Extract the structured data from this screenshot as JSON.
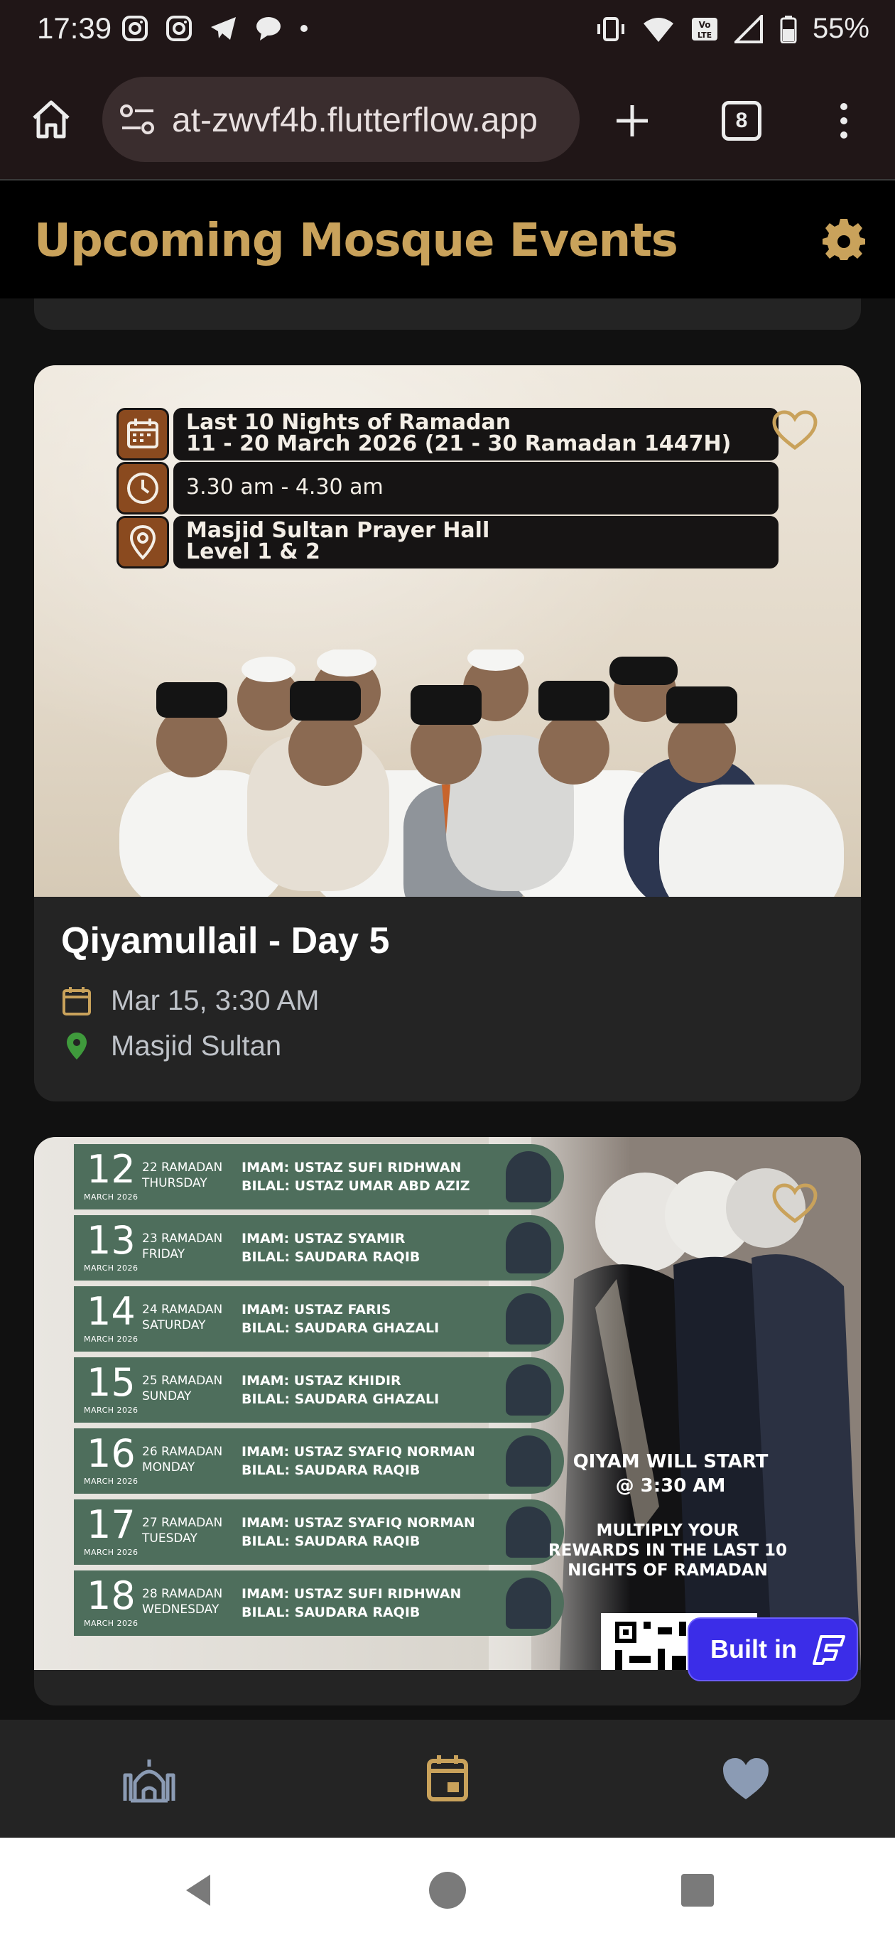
{
  "status_bar": {
    "time": "17:39",
    "battery": "55%",
    "icons_left": [
      "instagram-icon",
      "instagram-icon",
      "telegram-icon",
      "chat-icon",
      "dot-icon"
    ],
    "icons_right": [
      "vibrate-icon",
      "wifi-icon",
      "volte-icon",
      "signal-icon",
      "battery-icon"
    ]
  },
  "browser": {
    "url": "at-zwvf4b.flutterflow.app",
    "tab_count": "8"
  },
  "app": {
    "title": "Upcoming Mosque Events",
    "accent": "#c9a25b"
  },
  "events": [
    {
      "poster": {
        "line1": "Last 10 Nights of Ramadan",
        "line2": "11 - 20 March 2026 (21 - 30 Ramadan 1447H)",
        "time": "3.30 am - 4.30 am",
        "place1": "Masjid Sultan Prayer Hall",
        "place2": "Level 1 & 2"
      },
      "title": "Qiyamullail - Day 5",
      "date": "Mar 15, 3:30 AM",
      "location": "Masjid Sultan"
    },
    {
      "schedule": [
        {
          "day": "12",
          "month": "MARCH 2026",
          "ramadan": "22 RAMADAN",
          "weekday": "THURSDAY",
          "imam": "IMAM: USTAZ SUFI RIDHWAN",
          "bilal": "BILAL: USTAZ UMAR ABD AZIZ"
        },
        {
          "day": "13",
          "month": "MARCH 2026",
          "ramadan": "23 RAMADAN",
          "weekday": "FRIDAY",
          "imam": "IMAM: USTAZ SYAMIR",
          "bilal": "BILAL: SAUDARA RAQIB"
        },
        {
          "day": "14",
          "month": "MARCH 2026",
          "ramadan": "24 RAMADAN",
          "weekday": "SATURDAY",
          "imam": "IMAM: USTAZ FARIS",
          "bilal": "BILAL: SAUDARA GHAZALI"
        },
        {
          "day": "15",
          "month": "MARCH 2026",
          "ramadan": "25 RAMADAN",
          "weekday": "SUNDAY",
          "imam": "IMAM: USTAZ KHIDIR",
          "bilal": "BILAL: SAUDARA GHAZALI"
        },
        {
          "day": "16",
          "month": "MARCH 2026",
          "ramadan": "26 RAMADAN",
          "weekday": "MONDAY",
          "imam": "IMAM: USTAZ SYAFIQ NORMAN",
          "bilal": "BILAL: SAUDARA RAQIB"
        },
        {
          "day": "17",
          "month": "MARCH 2026",
          "ramadan": "27 RAMADAN",
          "weekday": "TUESDAY",
          "imam": "IMAM: USTAZ SYAFIQ NORMAN",
          "bilal": "BILAL: SAUDARA RAQIB"
        },
        {
          "day": "18",
          "month": "MARCH 2026",
          "ramadan": "28 RAMADAN",
          "weekday": "WEDNESDAY",
          "imam": "IMAM: USTAZ SUFI RIDHWAN",
          "bilal": "BILAL: SAUDARA RAQIB"
        }
      ],
      "qiyam_start": "QIYAM WILL START",
      "qiyam_time": "@ 3:30 AM",
      "multiply1": "MULTIPLY YOUR",
      "multiply2": "REWARDS IN THE LAST 10",
      "multiply3": "NIGHTS OF RAMADAN"
    }
  ],
  "badge": {
    "label": "Built in"
  },
  "nav": {
    "items": [
      "mosque-icon",
      "calendar-icon",
      "heart-icon"
    ],
    "active": "calendar-icon"
  },
  "system_nav": [
    "back-icon",
    "home-icon",
    "recents-icon"
  ]
}
